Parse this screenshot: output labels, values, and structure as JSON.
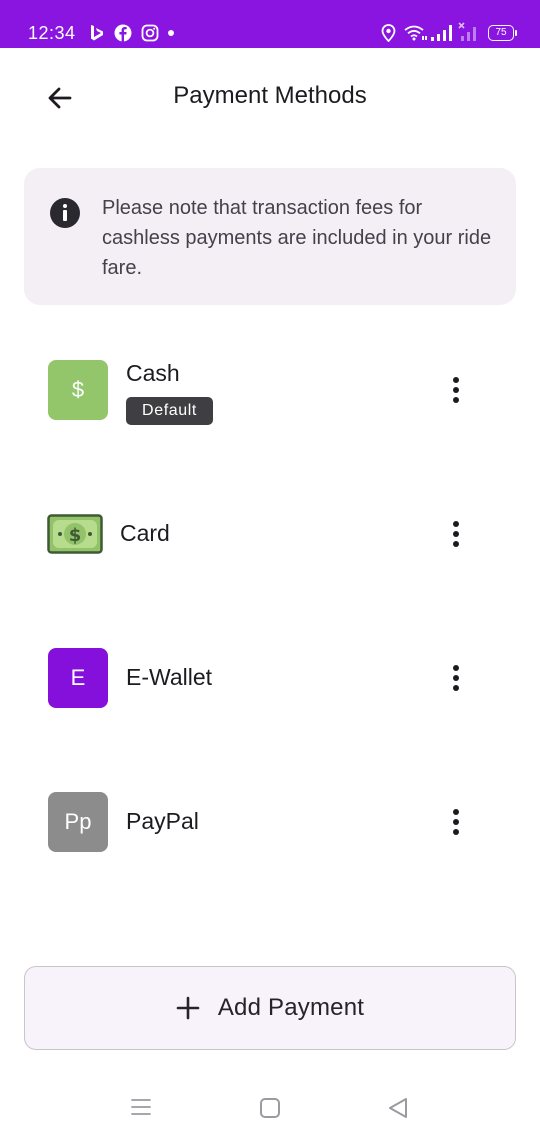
{
  "status_bar": {
    "time": "12:34",
    "battery_level": "75",
    "left_icons": [
      "bing-icon",
      "facebook-icon",
      "instagram-icon",
      "dot-icon"
    ],
    "right_icons": [
      "location-icon",
      "wifi-icon",
      "signal-icon",
      "signal-off-icon",
      "battery-icon"
    ]
  },
  "header": {
    "title": "Payment Methods",
    "back_icon": "arrow-left-icon"
  },
  "info": {
    "icon": "info-icon",
    "text": "Please note that transaction fees for cashless payments are included in your ride fare."
  },
  "payment_methods": [
    {
      "name": "Cash",
      "icon_text": "$",
      "icon": "dollar-icon",
      "icon_color": "#93c56b",
      "badge": "Default"
    },
    {
      "name": "Card",
      "icon_text": "",
      "icon": "banknote-icon",
      "icon_color": "#92c26a"
    },
    {
      "name": "E-Wallet",
      "icon_text": "E",
      "icon": "e-wallet-icon",
      "icon_color": "#8510dc"
    },
    {
      "name": "PayPal",
      "icon_text": "Pp",
      "icon": "paypal-icon",
      "icon_color": "#8c8c8c"
    }
  ],
  "more_icon": "more-vertical-icon",
  "add_button": {
    "label": "Add Payment",
    "icon": "plus-icon"
  },
  "nav_bar": {
    "icons": [
      "recent-apps-icon",
      "home-icon",
      "back-triangle-icon"
    ]
  },
  "colors": {
    "status_bar": "#8a14e0",
    "info_card_bg": "#f3eff4",
    "badge_bg": "#3f3e42",
    "add_button_bg": "#f8f2fb"
  }
}
